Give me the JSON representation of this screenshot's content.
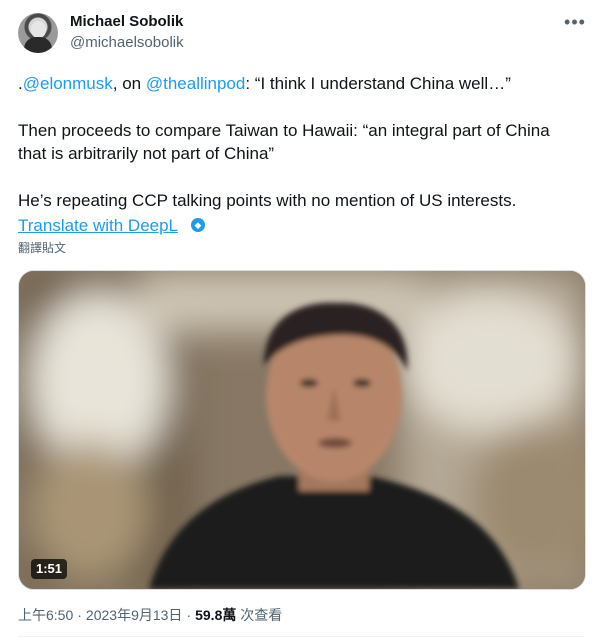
{
  "header": {
    "name": "Michael Sobolik",
    "handle": "@michaelsobolik",
    "more_icon": "more-horizontal-icon"
  },
  "post": {
    "line1_prefix": ".",
    "mention1": "@elonmusk",
    "line1_middle": ", on ",
    "mention2": "@theallinpod",
    "line1_suffix": ": “I think I understand China well…”",
    "paragraph2": "Then proceeds to compare Taiwan to Hawaii: “an integral part of China that is arbitrarily not part of China”",
    "paragraph3": "He’s repeating CCP talking points with no mention of US interests.",
    "translate_link": "Translate with DeepL",
    "translate_post": "翻譯貼文"
  },
  "media": {
    "duration": "1:51"
  },
  "meta": {
    "time": "上午6:50",
    "date": "2023年9月13日",
    "views_count": "59.8萬",
    "views_label": "次查看",
    "separator": "·"
  },
  "colors": {
    "link": "#1d9bf0",
    "secondary_text": "#536471",
    "primary_text": "#0f1419"
  }
}
